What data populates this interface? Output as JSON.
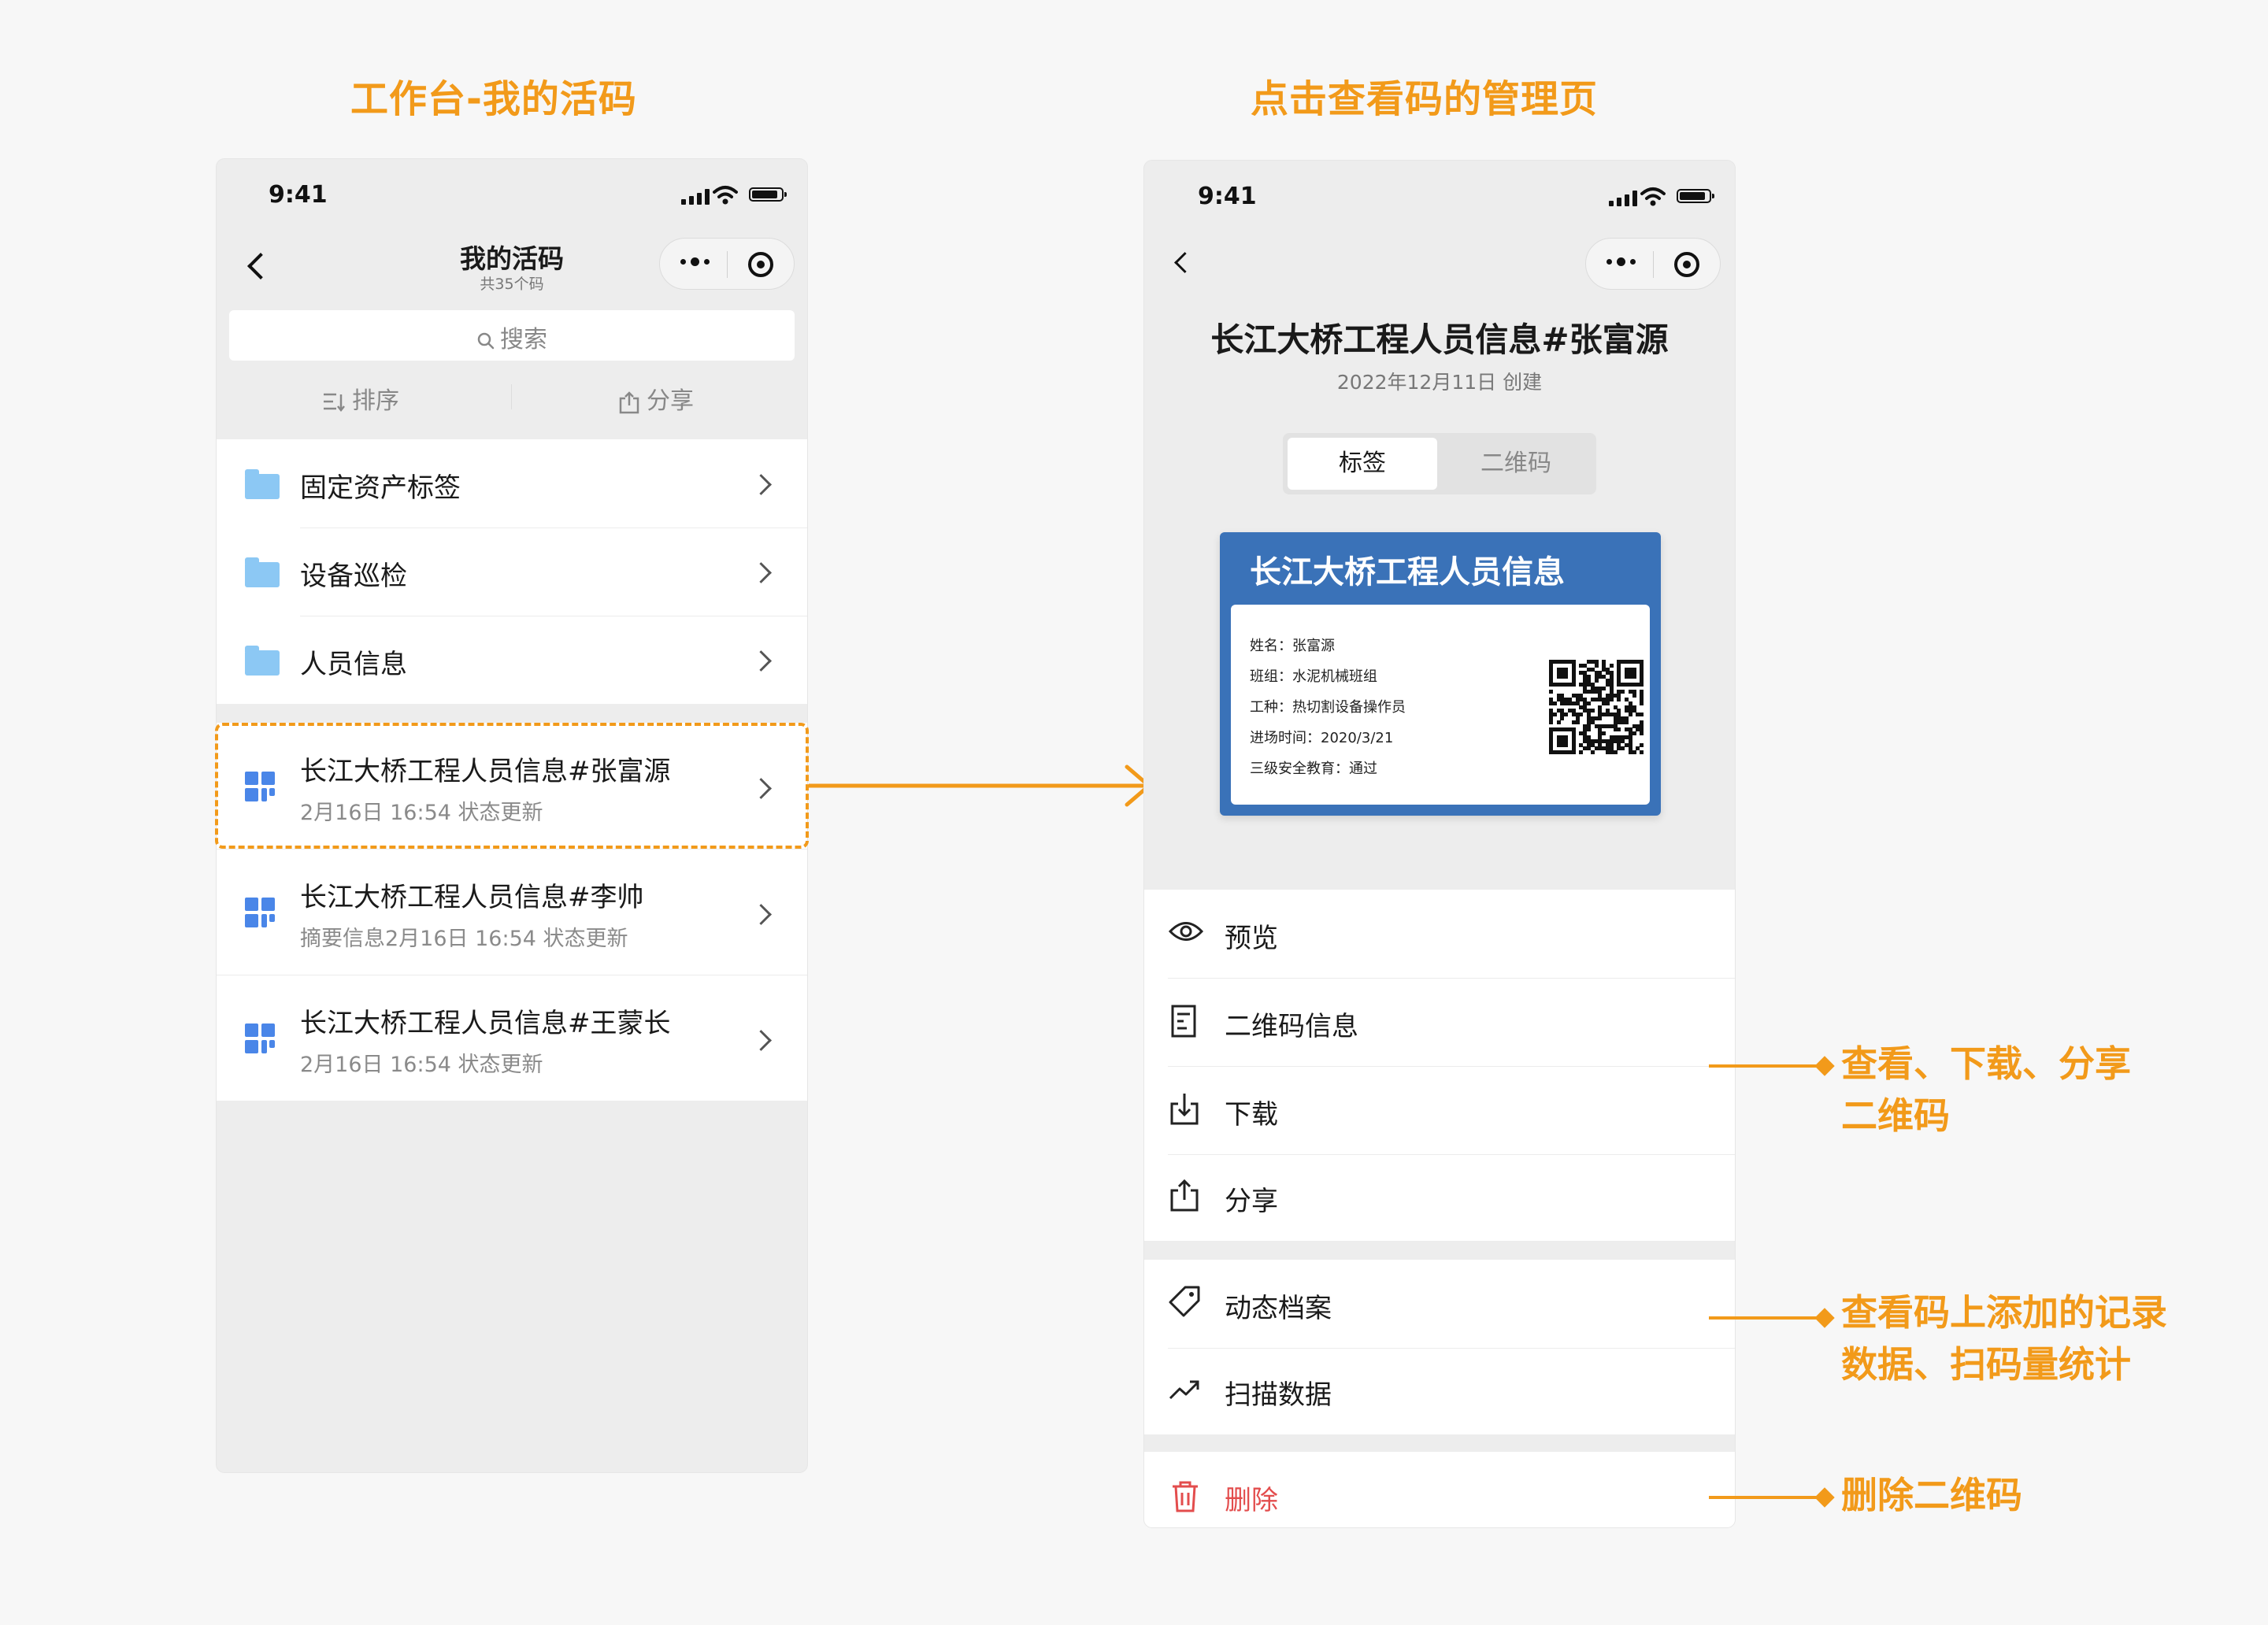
{
  "captions": {
    "left": "工作台-我的活码",
    "right": "点击查看码的管理页"
  },
  "left_phone": {
    "time": "9:41",
    "title": "我的活码",
    "subtitle": "共35个码",
    "search_placeholder": "搜索",
    "sort_label": "排序",
    "share_label": "分享",
    "folders": [
      "固定资产标签",
      "设备巡检",
      "人员信息"
    ],
    "codes": [
      {
        "title": "长江大桥工程人员信息#张富源",
        "sub": "2月16日 16:54 状态更新"
      },
      {
        "title": "长江大桥工程人员信息#李帅",
        "sub": "摘要信息2月16日 16:54 状态更新"
      },
      {
        "title": "长江大桥工程人员信息#王蒙长",
        "sub": "2月16日 16:54 状态更新"
      }
    ]
  },
  "right_phone": {
    "time": "9:41",
    "title": "长江大桥工程人员信息#张富源",
    "created": "2022年12月11日 创建",
    "tabs": [
      "标签",
      "二维码"
    ],
    "card": {
      "header": "长江大桥工程人员信息",
      "fields": [
        "姓名：张富源",
        "班组：水泥机械班组",
        "工种：热切割设备操作员",
        "进场时间：2020/3/21",
        "三级安全教育：通过"
      ]
    },
    "menu_group1": [
      "预览",
      "二维码信息",
      "下载",
      "分享"
    ],
    "menu_group2": [
      "动态档案",
      "扫描数据"
    ],
    "delete_label": "删除"
  },
  "callouts": {
    "c1_line1": "查看、下载、分享",
    "c1_line2": "二维码",
    "c2_line1": "查看码上添加的记录",
    "c2_line2": "数据、扫码量统计",
    "c3": "删除二维码"
  },
  "colors": {
    "accent": "#f29a1a",
    "card_blue": "#3a72b8",
    "delete_red": "#e34d4d",
    "icon_blue": "#4a86e8",
    "folder_blue": "#8cc8f4"
  }
}
